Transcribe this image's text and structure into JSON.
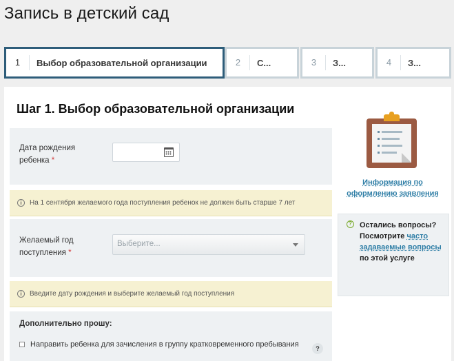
{
  "page": {
    "title": "Запись в детский сад"
  },
  "steps": [
    {
      "num": "1",
      "label": "Выбор образовательной организации",
      "active": true
    },
    {
      "num": "2",
      "label": "С..."
    },
    {
      "num": "3",
      "label": "З..."
    },
    {
      "num": "4",
      "label": "З..."
    }
  ],
  "form": {
    "heading": "Шаг 1. Выбор образовательной организации",
    "birth_date": {
      "label_line1": "Дата рождения",
      "label_line2": "ребенка",
      "required_mark": "*",
      "value": "",
      "icon": "calendar-icon"
    },
    "notice_age": "На 1 сентября желаемого года поступления ребенок не должен быть старше 7 лет",
    "admission_year": {
      "label_line1": "Желаемый год",
      "label_line2": "поступления",
      "required_mark": "*",
      "placeholder": "Выберите..."
    },
    "notice_enter": "Введите дату рождения и выберите желаемый год поступления",
    "extra": {
      "title": "Дополнительно прошу:",
      "short_stay_label": "Направить ребенка для зачисления в группу кратковременного пребывания",
      "short_stay_checked": false,
      "help_label": "?"
    }
  },
  "sidebar": {
    "info_icon": "clipboard-icon",
    "info_link_line1": "Информация по",
    "info_link_line2": "оформлению заявления",
    "faq": {
      "icon_text": "?",
      "text_before": "Остались вопросы? Посмотрите ",
      "link": "часто задаваемые вопросы",
      "text_after": " по этой услуге"
    }
  },
  "colors": {
    "active_step_border": "#2e5d7a",
    "link": "#2f7ea6",
    "notice_bg": "#f6f1d2",
    "required": "#d23b3b",
    "faq_icon": "#7aaa2c"
  }
}
